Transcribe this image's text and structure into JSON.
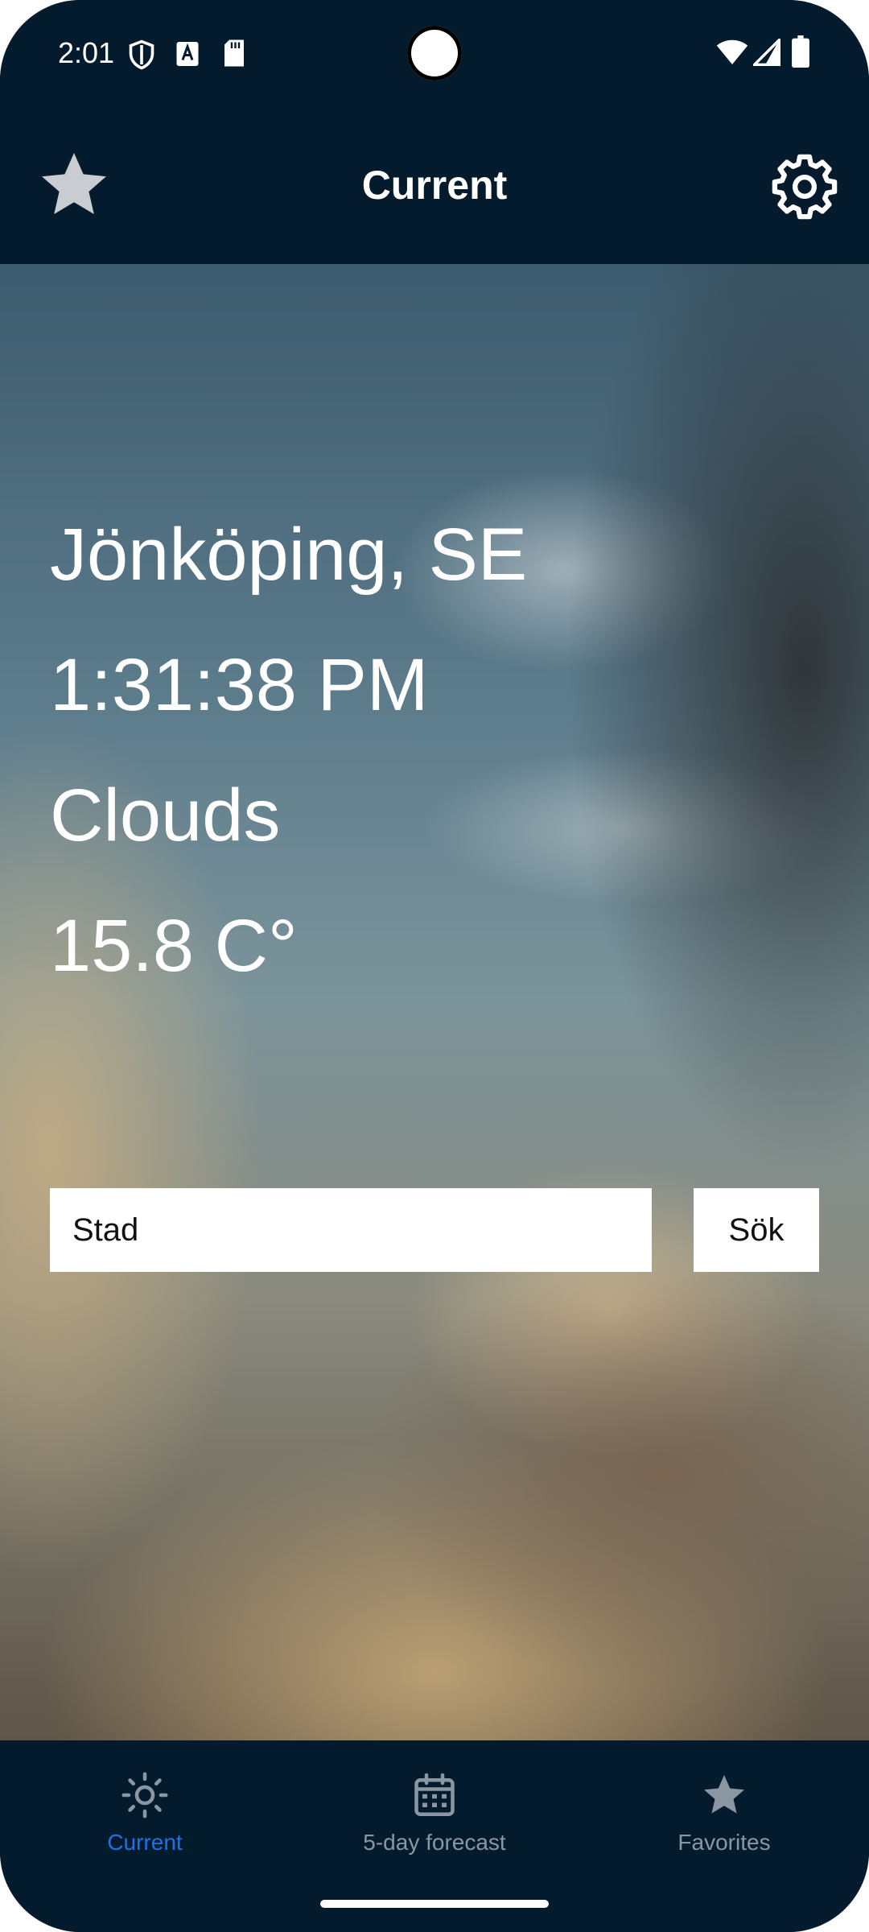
{
  "status_bar": {
    "time": "2:01",
    "icons": [
      "shield-icon",
      "font-a-icon",
      "sd-card-icon",
      "wifi-icon",
      "signal-icon",
      "battery-icon"
    ]
  },
  "app_bar": {
    "title": "Current",
    "left_icon": "star-icon",
    "right_icon": "gear-icon"
  },
  "weather": {
    "location": "Jönköping, SE",
    "time": "1:31:38 PM",
    "condition": "Clouds",
    "temperature": "15.8 C°"
  },
  "search": {
    "placeholder": "Stad",
    "button_label": "Sök"
  },
  "bottom_nav": {
    "items": [
      {
        "label": "Current",
        "icon": "sun-icon",
        "active": true
      },
      {
        "label": "5-day forecast",
        "icon": "calendar-icon",
        "active": false
      },
      {
        "label": "Favorites",
        "icon": "star-icon",
        "active": false
      }
    ]
  },
  "colors": {
    "bar_background": "#041b2d",
    "active_nav": "#1a73e8",
    "inactive_nav": "#8a97a3",
    "favorite_star": "#c9ccd0"
  }
}
